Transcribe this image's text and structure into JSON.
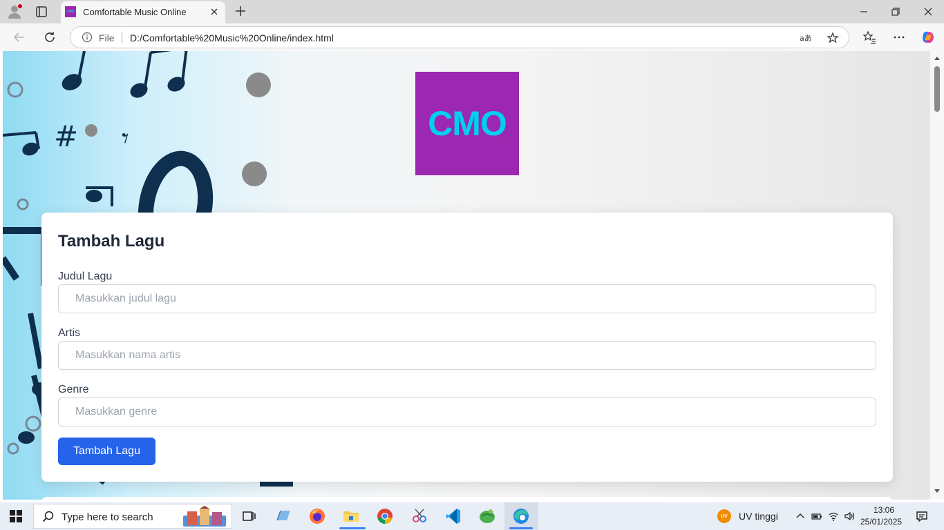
{
  "browser": {
    "tab_title": "Comfortable Music Online",
    "favicon_text": "CMO",
    "file_label": "File",
    "url": "D:/Comfortable%20Music%20Online/index.html"
  },
  "page": {
    "logo_text": "CMO",
    "colors": {
      "logo_bg": "#9c27b0",
      "logo_text": "#00d0f0",
      "button": "#2563eb"
    },
    "form": {
      "title": "Tambah Lagu",
      "fields": [
        {
          "label": "Judul Lagu",
          "placeholder": "Masukkan judul lagu"
        },
        {
          "label": "Artis",
          "placeholder": "Masukkan nama artis"
        },
        {
          "label": "Genre",
          "placeholder": "Masukkan genre"
        }
      ],
      "submit_label": "Tambah Lagu"
    }
  },
  "taskbar": {
    "search_placeholder": "Type here to search",
    "weather_badge": "UV",
    "weather_text": "UV tinggi",
    "time": "13:06",
    "date": "25/01/2025"
  }
}
